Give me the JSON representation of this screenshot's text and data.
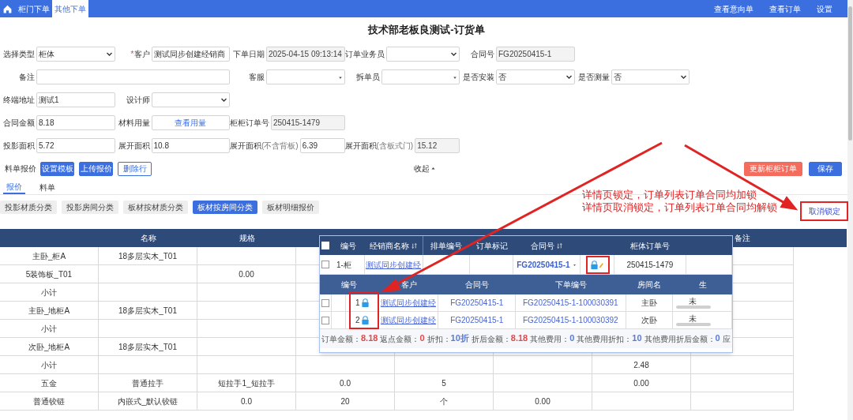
{
  "topbar": {
    "tabs": [
      {
        "label": "柜门下单",
        "selected": false
      },
      {
        "label": "其他下单",
        "selected": true
      }
    ],
    "links": [
      "查看意向单",
      "查看订单",
      "设置"
    ]
  },
  "title": "技术部老板良测试-订货单",
  "form": {
    "required_mark": "*",
    "rows": [
      [
        {
          "label": "选择类型",
          "kind": "select",
          "value": "柜体",
          "required": false
        },
        {
          "label": "客户",
          "kind": "text",
          "value": "测试同步创建经销商",
          "required": true
        },
        {
          "label": "下单日期",
          "kind": "readonly",
          "value": "2025-04-15 09:13:14",
          "required": false
        },
        {
          "label": "订单业务员",
          "kind": "select",
          "required": false
        },
        {
          "label": "合同号",
          "kind": "readonly",
          "value": "FG20250415-1",
          "required": false
        }
      ],
      [
        {
          "label": "备注",
          "kind": "textarea",
          "required": false
        },
        null,
        {
          "label": "客服",
          "kind": "dropdown",
          "required": false
        },
        {
          "label": "拆单员",
          "kind": "dropdown",
          "required": false
        },
        {
          "label": "是否安装",
          "kind": "select",
          "value": "否",
          "required": false
        },
        {
          "label": "是否测量",
          "kind": "select",
          "value": "否",
          "required": false
        }
      ],
      [
        {
          "label": "终端地址",
          "kind": "text",
          "value": "测试1",
          "required": false
        },
        {
          "label": "设计师",
          "kind": "select",
          "required": false
        }
      ],
      [
        {
          "label": "合同金额",
          "kind": "text",
          "value": "8.18",
          "required": false
        },
        {
          "label": "材料用量",
          "kind": "link",
          "value": "查看用量",
          "required": false
        },
        {
          "label": "柜柜订单号",
          "kind": "readonly",
          "value": "250415-1479",
          "required": false
        }
      ],
      [
        {
          "label": "投影面积",
          "kind": "text",
          "value": "5.72",
          "required": false
        },
        {
          "label": "展开面积",
          "kind": "text",
          "value": "10.8",
          "required": false
        },
        {
          "label": "展开面积",
          "note": "(不含背板)",
          "kind": "text",
          "value": "6.39",
          "required": false
        },
        {
          "label": "展开面积",
          "note": "(含板式门)",
          "kind": "readonly",
          "value": "15.12",
          "required": false
        }
      ]
    ]
  },
  "actions": {
    "label": "料单报价",
    "buttons": [
      {
        "label": "设置模板",
        "kind": "primary"
      },
      {
        "label": "上传报价",
        "kind": "primary"
      },
      {
        "label": "删除行",
        "kind": "outline"
      }
    ],
    "collapse": "收起",
    "right_buttons": [
      {
        "label": "更新柜柜订单",
        "kind": "danger"
      },
      {
        "label": "保存",
        "kind": "primary"
      }
    ]
  },
  "tabs": [
    {
      "label": "报价",
      "selected": true
    },
    {
      "label": "料单",
      "selected": false
    }
  ],
  "categories": [
    {
      "label": "投影材质分类",
      "selected": false
    },
    {
      "label": "投影房间分类",
      "selected": false
    },
    {
      "label": "板材按材质分类",
      "selected": false
    },
    {
      "label": "板材按房间分类",
      "selected": true
    },
    {
      "label": "板材明细报价",
      "selected": false
    }
  ],
  "unlock_link": "取消锁定",
  "annotation": {
    "lines": [
      "详情页锁定，订单列表订单合同均加锁",
      "详情页取消锁定，订单列表订单合同均解锁"
    ]
  },
  "table": {
    "columns": [
      null,
      "名称",
      "规格",
      null,
      null,
      null,
      null,
      "备注"
    ],
    "rows": [
      [
        "主卧_柜A",
        "18多层实木_T01",
        null,
        null,
        null,
        null,
        null,
        null
      ],
      [
        "5装饰板_T01",
        null,
        "0.00",
        null,
        null,
        null,
        null,
        null
      ],
      [
        "小计",
        null,
        null,
        null,
        null,
        null,
        null,
        null
      ],
      [
        "主卧_地柜A",
        "18多层实木_T01",
        null,
        null,
        null,
        null,
        null,
        null
      ],
      [
        "小计",
        null,
        null,
        null,
        null,
        null,
        null,
        null
      ],
      [
        "次卧_地柜A",
        "18多层实木_T01",
        null,
        null,
        null,
        null,
        null,
        null
      ],
      [
        "小计",
        null,
        null,
        null,
        null,
        null,
        "2.48",
        null
      ],
      [
        "五金",
        "普通拉手",
        "短拉手1_短拉手",
        "0.0",
        "5",
        null,
        "0.00",
        null
      ],
      [
        "普通铰链",
        "内嵌式_默认铰链",
        "0.0",
        "20",
        "个",
        "0.00",
        null,
        null
      ]
    ]
  },
  "popup": {
    "columns": [
      {
        "label": "编号",
        "sortable": false
      },
      {
        "label": "经销商名称",
        "sortable": true
      },
      {
        "label": "排单编号",
        "sortable": false
      },
      {
        "label": "订单标记",
        "sortable": false
      },
      {
        "label": "合同号",
        "sortable": true
      },
      {
        "label": "柜体订单号",
        "sortable": false
      }
    ],
    "header_checked": false,
    "order": {
      "checked": false,
      "number": "1-柜",
      "dealer": "测试同步创建经",
      "contract": "FG20250415-1",
      "locked": true,
      "cabinet_order": "250415-1479"
    },
    "sub_columns": [
      "编号",
      "客户",
      "合同号",
      "下单编号",
      "房间名",
      "生"
    ],
    "sub_rows": [
      {
        "checked": false,
        "number": "1",
        "locked": true,
        "customer": "测试同步创建经",
        "contract": "FG20250415-1",
        "order_no": "FG20250415-1-100030391",
        "room": "主卧",
        "production": "未",
        "level": 0
      },
      {
        "checked": false,
        "number": "2",
        "locked": true,
        "customer": "测试同步创建经",
        "contract": "FG20250415-1",
        "order_no": "FG20250415-1-100030392",
        "room": "次卧",
        "production": "未",
        "level": 0
      }
    ],
    "totals": [
      {
        "label": "订单金额：",
        "value": "8.18",
        "color": "#e5484d"
      },
      {
        "label": "返点金额：",
        "value": "0",
        "color": "#e5484d"
      },
      {
        "label": "折扣：",
        "value": "10折",
        "color": "#5b7bd5"
      },
      {
        "label": "折后金额：",
        "value": "8.18",
        "color": "#e5484d"
      },
      {
        "label": "其他费用：",
        "value": "0",
        "color": "#5b7bd5"
      },
      {
        "label": "其他费用折扣：",
        "value": "10",
        "color": "#5b7bd5"
      },
      {
        "label": "其他费用折后金额：",
        "value": "0",
        "color": "#5b7bd5"
      },
      {
        "label": "应"
      }
    ]
  }
}
